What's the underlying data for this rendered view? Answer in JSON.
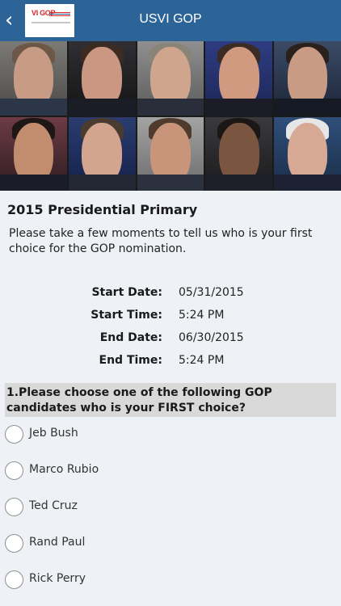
{
  "header": {
    "title": "USVI GOP",
    "back_icon": "chevron-left-icon",
    "logo_text": "VI GOP",
    "color": "#2d6497"
  },
  "banner": {
    "description": "photo grid of 10 GOP candidates"
  },
  "survey": {
    "title": "2015 Presidential Primary",
    "description": "Please take a few moments to tell us who is your first choice for the GOP nomination.",
    "details": [
      {
        "label": "Start Date:",
        "value": "05/31/2015"
      },
      {
        "label": "Start Time:",
        "value": "5:24 PM"
      },
      {
        "label": "End Date:",
        "value": "06/30/2015"
      },
      {
        "label": "End Time:",
        "value": "5:24 PM"
      }
    ],
    "question": "1.Please choose one of the following GOP candidates who is your FIRST choice?",
    "options": [
      {
        "label": "Jeb Bush"
      },
      {
        "label": "Marco Rubio"
      },
      {
        "label": "Ted Cruz"
      },
      {
        "label": "Rand Paul"
      },
      {
        "label": "Rick Perry"
      }
    ]
  }
}
